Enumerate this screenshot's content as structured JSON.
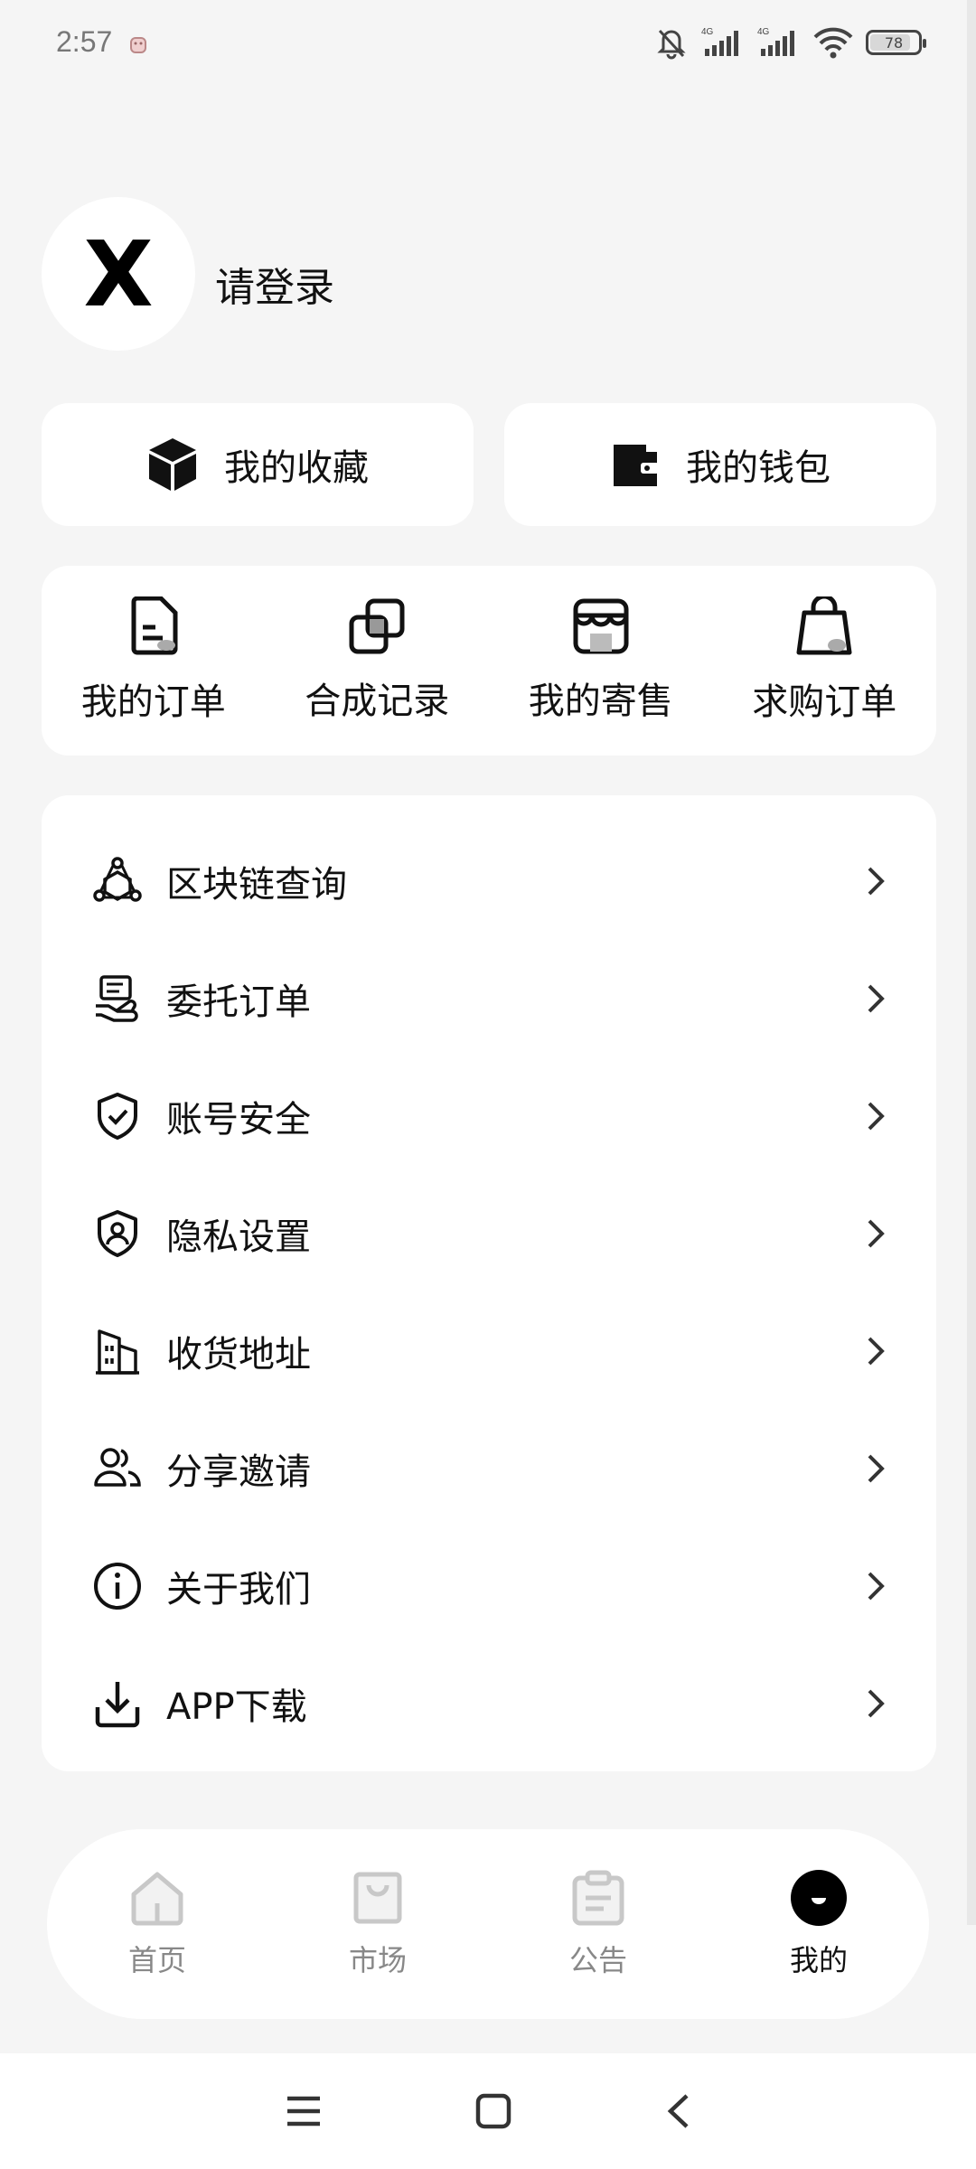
{
  "status_bar": {
    "time": "2:57",
    "network_1": "4G",
    "network_2": "4G",
    "battery_level": "78",
    "battery_percent": 78
  },
  "profile": {
    "avatar_letter": "X",
    "login_label": "请登录"
  },
  "quick_actions": [
    {
      "label": "我的收藏",
      "icon": "cube-icon"
    },
    {
      "label": "我的钱包",
      "icon": "wallet-icon"
    }
  ],
  "orders": [
    {
      "label": "我的订单",
      "icon": "document-icon"
    },
    {
      "label": "合成记录",
      "icon": "overlap-squares-icon"
    },
    {
      "label": "我的寄售",
      "icon": "store-icon"
    },
    {
      "label": "求购订单",
      "icon": "shopping-bag-icon"
    }
  ],
  "menu": [
    {
      "label": "区块链查询",
      "icon": "blockchain-icon"
    },
    {
      "label": "委托订单",
      "icon": "hand-bill-icon"
    },
    {
      "label": "账号安全",
      "icon": "shield-check-icon"
    },
    {
      "label": "隐私设置",
      "icon": "privacy-shield-icon"
    },
    {
      "label": "收货地址",
      "icon": "building-icon"
    },
    {
      "label": "分享邀请",
      "icon": "users-icon"
    },
    {
      "label": "关于我们",
      "icon": "info-icon"
    },
    {
      "label": "APP下载",
      "icon": "download-icon"
    }
  ],
  "bottom_nav": [
    {
      "label": "首页",
      "icon": "home-icon",
      "active": false
    },
    {
      "label": "市场",
      "icon": "bag-icon",
      "active": false
    },
    {
      "label": "公告",
      "icon": "notice-icon",
      "active": false
    },
    {
      "label": "我的",
      "icon": "profile-icon",
      "active": true
    }
  ],
  "system_nav": [
    "menu-icon",
    "home-square-icon",
    "back-icon"
  ]
}
